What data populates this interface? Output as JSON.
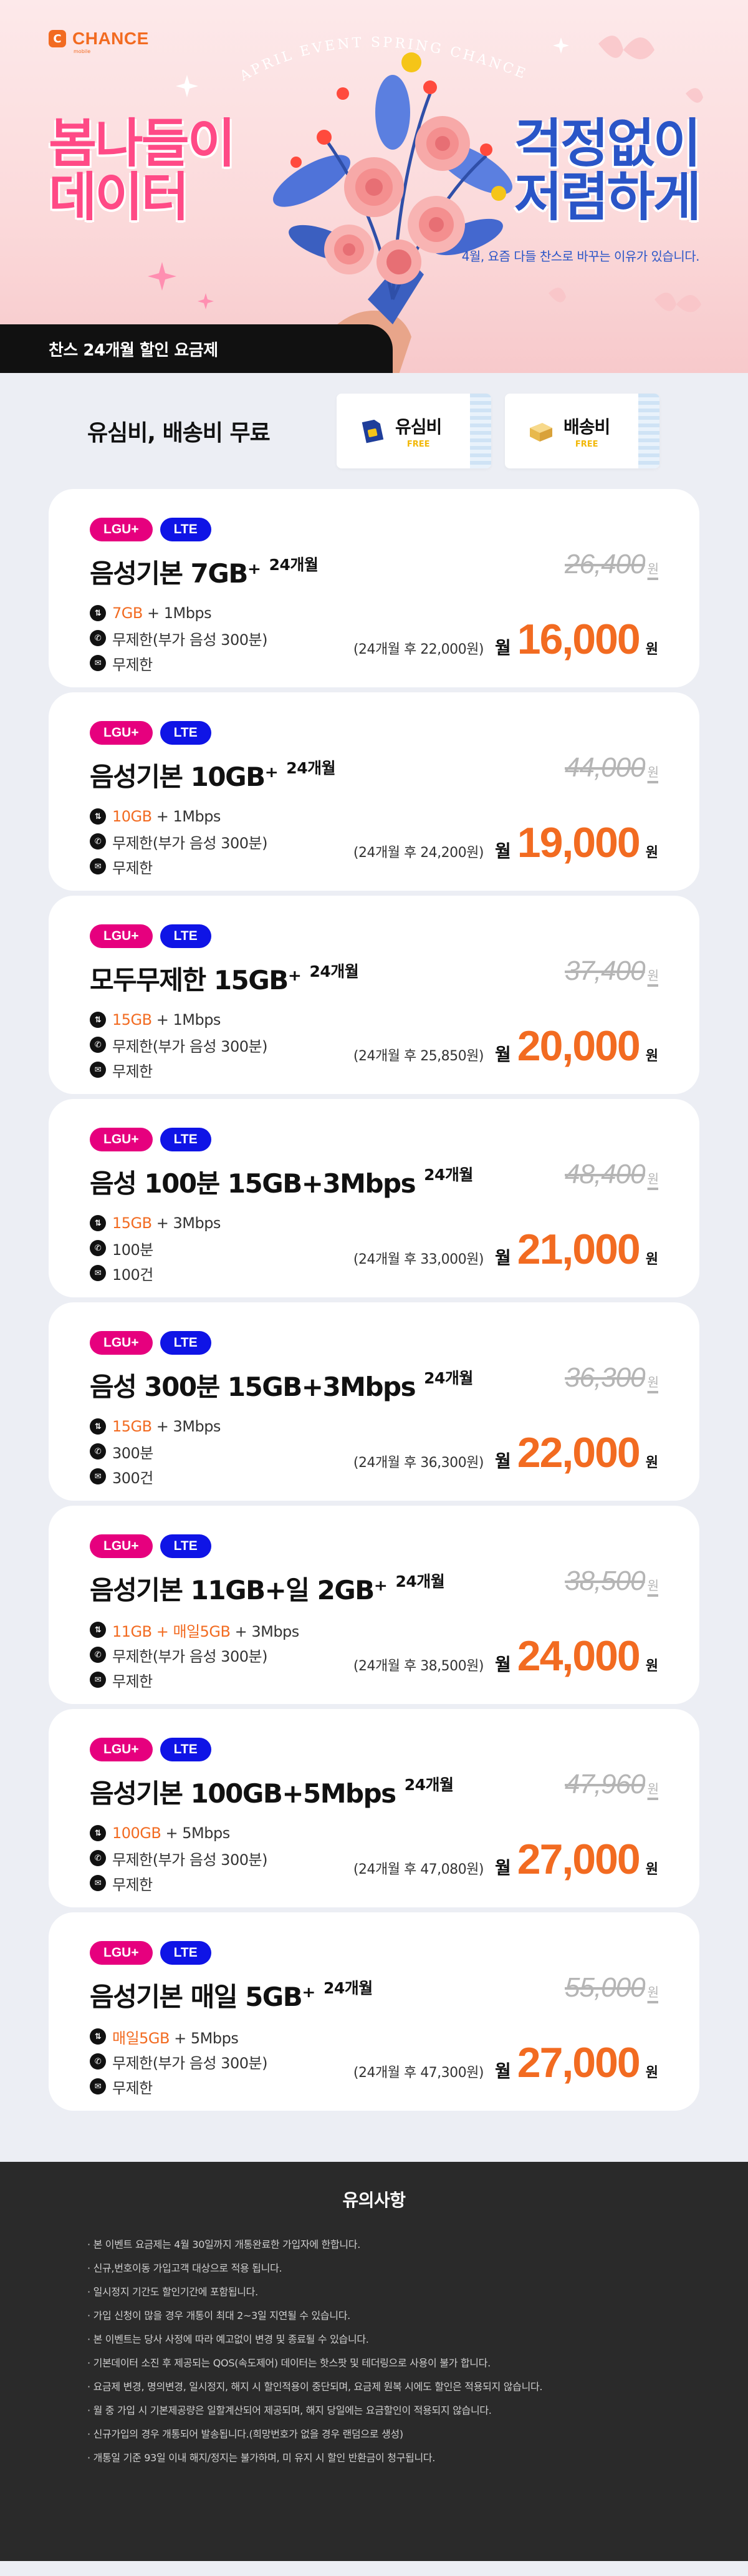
{
  "hero": {
    "logo_mark": "C",
    "logo_text": "CHANCE",
    "logo_sub": "mobile",
    "arc_text": "APRIL EVENT SPRING CHANCE",
    "headline_left_1": "봄나들이",
    "headline_left_2": "데이터",
    "headline_right_1": "걱정없이",
    "headline_right_2": "저렴하게",
    "subtitle": "4월, 요즘 다들 찬스로 바꾸는 이유가 있습니다.",
    "promo_bar": "찬스 24개월 할인 요금제",
    "colors": {
      "pink": "#ff4a86",
      "blue": "#2a55c7",
      "orange": "#f26b21"
    }
  },
  "free": {
    "title": "유심비, 배송비 무료",
    "tickets": [
      {
        "label": "유심비",
        "free": "FREE",
        "icon": "sim-card-icon"
      },
      {
        "label": "배송비",
        "free": "FREE",
        "icon": "delivery-box-icon"
      }
    ]
  },
  "plans": [
    {
      "carrier": "LGU+",
      "network": "LTE",
      "name": "음성기본 7GB⁺",
      "term": "24개월",
      "data_hl": "7GB",
      "data_rest": " + 1Mbps",
      "voice": "무제한(부가 음성 300분)",
      "sms": "무제한",
      "original_price": "26,400",
      "after_text": "(24개월 후 22,000원)",
      "month": "월",
      "price": "16,000",
      "won": "원"
    },
    {
      "carrier": "LGU+",
      "network": "LTE",
      "name": "음성기본 10GB⁺",
      "term": "24개월",
      "data_hl": "10GB",
      "data_rest": " + 1Mbps",
      "voice": "무제한(부가 음성 300분)",
      "sms": "무제한",
      "original_price": "44,000",
      "after_text": "(24개월 후 24,200원)",
      "month": "월",
      "price": "19,000",
      "won": "원"
    },
    {
      "carrier": "LGU+",
      "network": "LTE",
      "name": "모두무제한 15GB⁺",
      "term": "24개월",
      "data_hl": "15GB",
      "data_rest": " + 1Mbps",
      "voice": "무제한(부가 음성 300분)",
      "sms": "무제한",
      "original_price": "37,400",
      "after_text": "(24개월 후 25,850원)",
      "month": "월",
      "price": "20,000",
      "won": "원"
    },
    {
      "carrier": "LGU+",
      "network": "LTE",
      "name": "음성 100분 15GB+3Mbps",
      "term": "24개월",
      "data_hl": "15GB",
      "data_rest": " + 3Mbps",
      "voice": "100분",
      "sms": "100건",
      "original_price": "48,400",
      "after_text": "(24개월 후 33,000원)",
      "month": "월",
      "price": "21,000",
      "won": "원"
    },
    {
      "carrier": "LGU+",
      "network": "LTE",
      "name": "음성 300분 15GB+3Mbps",
      "term": "24개월",
      "data_hl": "15GB",
      "data_rest": " + 3Mbps",
      "voice": "300분",
      "sms": "300건",
      "original_price": "36,300",
      "after_text": "(24개월 후 36,300원)",
      "month": "월",
      "price": "22,000",
      "won": "원"
    },
    {
      "carrier": "LGU+",
      "network": "LTE",
      "name": "음성기본 11GB+일 2GB⁺",
      "term": "24개월",
      "data_hl": "11GB + 매일5GB",
      "data_rest": " + 3Mbps",
      "voice": "무제한(부가 음성 300분)",
      "sms": "무제한",
      "original_price": "38,500",
      "after_text": "(24개월 후 38,500원)",
      "month": "월",
      "price": "24,000",
      "won": "원"
    },
    {
      "carrier": "LGU+",
      "network": "LTE",
      "name": "음성기본 100GB+5Mbps",
      "term": "24개월",
      "data_hl": "100GB",
      "data_rest": " + 5Mbps",
      "voice": "무제한(부가 음성 300분)",
      "sms": "무제한",
      "original_price": "47,960",
      "after_text": "(24개월 후 47,080원)",
      "month": "월",
      "price": "27,000",
      "won": "원"
    },
    {
      "carrier": "LGU+",
      "network": "LTE",
      "name": "음성기본 매일 5GB⁺",
      "term": "24개월",
      "data_hl": "매일5GB",
      "data_rest": " + 5Mbps",
      "voice": "무제한(부가 음성 300분)",
      "sms": "무제한",
      "original_price": "55,000",
      "after_text": "(24개월 후 47,300원)",
      "month": "월",
      "price": "27,000",
      "won": "원"
    }
  ],
  "price_won_unit": "원",
  "notice": {
    "title": "유의사항",
    "items": [
      "본 이벤트 요금제는 4월 30일까지 개통완료한 가입자에 한합니다.",
      "신규,번호이동 가입고객 대상으로 적용 됩니다.",
      "일시정지 기간도 할인기간에 포함됩니다.",
      "가입 신청이 많을 경우 개통이 최대 2~3일 지연될 수 있습니다.",
      "본 이벤트는 당사 사정에 따라 예고없이 변경 및 종료될 수 있습니다.",
      "기본데이터 소진 후 제공되는 QOS(속도제어) 데이터는 핫스팟 및 테더링으로 사용이 불가 합니다.",
      "요금제 변경, 명의변경, 일시정지, 해지 시 할인적용이 중단되며, 요금제 원복 시에도 할인은 적용되지 않습니다.",
      "월 중 가입 시 기본제공량은 일할계산되어 제공되며, 해지 당일에는 요금할인이 적용되지 않습니다.",
      "신규가입의 경우 개통되어 발송됩니다.(희망번호가 없을 경우 랜덤으로 생성)",
      "개통일 기준 93일 이내 해지/정지는 불가하며, 미 유지 시 할인 반환금이 청구됩니다."
    ]
  }
}
